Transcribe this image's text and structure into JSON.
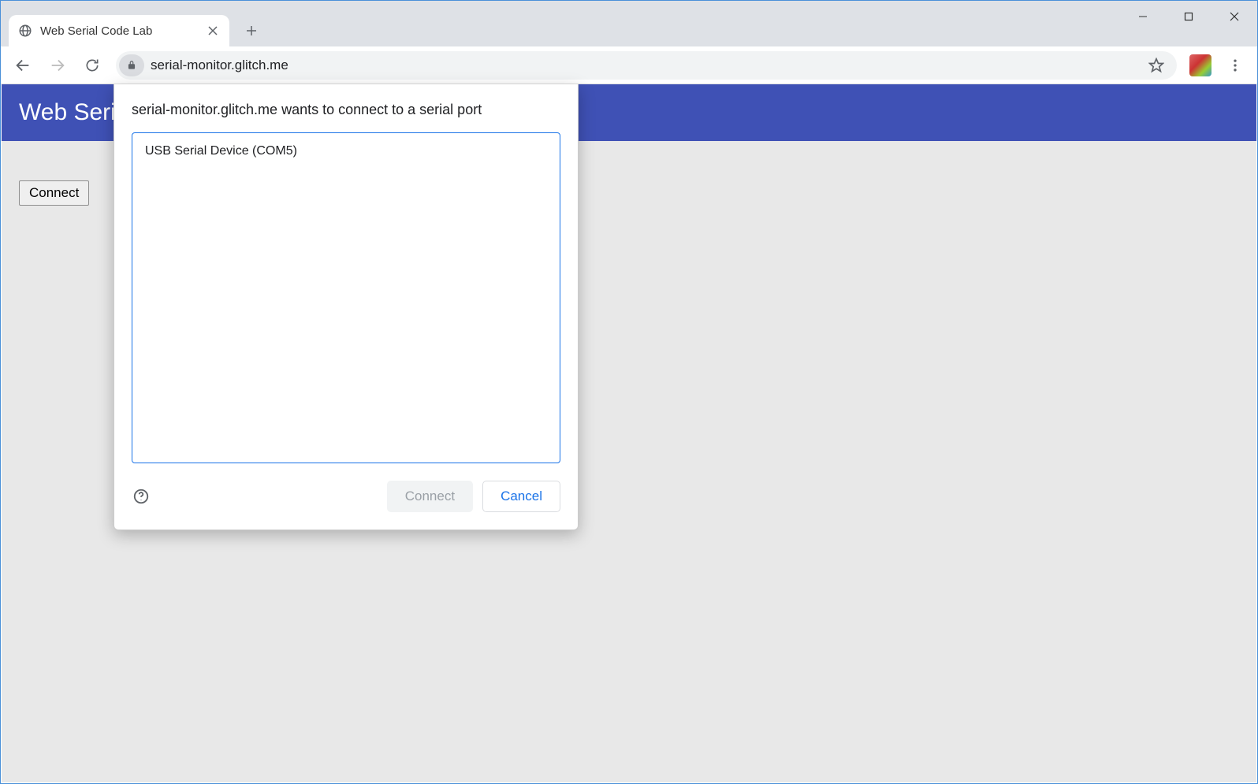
{
  "browser": {
    "tab_title": "Web Serial Code Lab",
    "url": "serial-monitor.glitch.me"
  },
  "page": {
    "header_title": "Web Serial",
    "connect_button": "Connect"
  },
  "dialog": {
    "title": "serial-monitor.glitch.me wants to connect to a serial port",
    "devices": [
      "USB Serial Device (COM5)"
    ],
    "connect_label": "Connect",
    "cancel_label": "Cancel"
  }
}
